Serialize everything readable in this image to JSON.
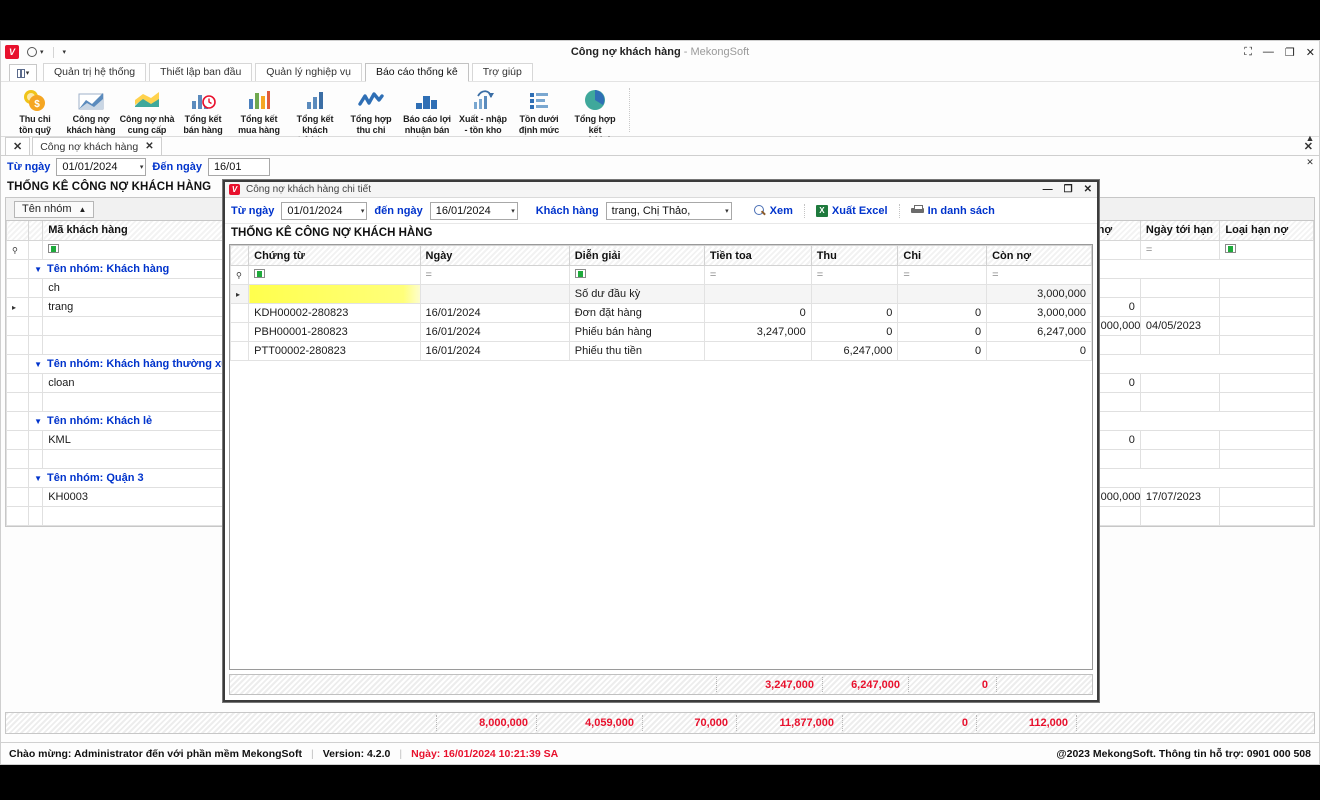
{
  "window": {
    "title": "Công nợ khách hàng",
    "title_suffix": "- MekongSoft",
    "logo": "V",
    "controls": {
      "restore_small": "⛶",
      "minimize": "—",
      "maximize": "❐",
      "close": "✕"
    }
  },
  "ribbon": {
    "tabs": [
      {
        "label": "Quản trị hệ thống",
        "active": false
      },
      {
        "label": "Thiết lập ban đầu",
        "active": false
      },
      {
        "label": "Quản lý nghiệp vụ",
        "active": false
      },
      {
        "label": "Báo cáo thống kê",
        "active": true
      },
      {
        "label": "Trợ giúp",
        "active": false
      }
    ],
    "buttons": [
      {
        "line1": "Thu chi",
        "line2": "tồn quỹ",
        "icon": "coins-money-icon"
      },
      {
        "line1": "Công nợ",
        "line2": "khách hàng",
        "icon": "area-chart-icon"
      },
      {
        "line1": "Công nợ nhà",
        "line2": "cung cấp",
        "icon": "layered-area-icon"
      },
      {
        "line1": "Tổng kết",
        "line2": "bán hàng",
        "icon": "bar-chart-clock-icon"
      },
      {
        "line1": "Tổng kết",
        "line2": "mua hàng",
        "icon": "color-bars-icon"
      },
      {
        "line1": "Tổng kết khách",
        "line2": "trả hàng",
        "icon": "small-bars-icon"
      },
      {
        "line1": "Tổng hợp",
        "line2": "thu chi",
        "icon": "zigzag-line-icon"
      },
      {
        "line1": "Báo cáo lợi",
        "line2": "nhuận bán hàng",
        "icon": "building-bars-icon"
      },
      {
        "line1": "Xuất - nhập",
        "line2": "- tồn kho",
        "icon": "bars-arrow-icon"
      },
      {
        "line1": "Tồn dưới",
        "line2": "định mức",
        "icon": "list-bars-icon"
      },
      {
        "line1": "Tổng hợp kết",
        "line2": "quả kinh doanh",
        "icon": "pie-chart-icon"
      }
    ]
  },
  "doctabs": {
    "close_all": "✕",
    "tabs": [
      {
        "label": "Công nợ khách hàng",
        "close": "✕"
      }
    ],
    "right_close": "✕"
  },
  "main_filter": {
    "from_label": "Từ ngày",
    "from_value": "01/01/2024",
    "to_label": "Đến ngày",
    "to_value": "16/01"
  },
  "main_heading": "THỐNG KÊ CÔNG NỢ KHÁCH HÀNG",
  "groupbar": {
    "chip": "Tên nhóm",
    "sort_arrow": "▲"
  },
  "main_grid": {
    "columns": [
      "Mã khách hàng",
      "nợ",
      "Ngày tới hạn",
      "Loại hạn nợ"
    ],
    "filter_row": [
      "filter-icon",
      "",
      "=",
      "filter-icon"
    ],
    "groups": [
      {
        "title": "Tên nhóm: Khách hàng",
        "rows": [
          {
            "code": "ch",
            "no": "",
            "ngay_toi_han": "",
            "loai": "",
            "selected": false
          },
          {
            "code": "trang",
            "no": "",
            "ngay_toi_han": "",
            "loai": "",
            "selected": true
          }
        ]
      },
      {
        "title": "Tên nhóm: Khách hàng thường xuyên",
        "rows": [
          {
            "code": "cloan",
            "no": "0",
            "ngay_toi_han": "",
            "loai": "",
            "selected": false
          }
        ]
      },
      {
        "title": "Tên nhóm: Khách lẻ",
        "rows": [
          {
            "code": "KML",
            "no": "0",
            "ngay_toi_han": "",
            "loai": "",
            "selected": false
          }
        ]
      },
      {
        "title": "Tên nhóm: Quận 3",
        "rows": [
          {
            "code": "KH0003",
            "no": ",000,000",
            "ngay_toi_han": "17/07/2023",
            "loai": "",
            "selected": false
          }
        ]
      }
    ],
    "right_values": [
      {
        "no": "0",
        "date": ""
      },
      {
        "no": ",000,000",
        "date": "04/05/2023"
      }
    ]
  },
  "main_totals": [
    "8,000,000",
    "4,059,000",
    "70,000",
    "11,877,000",
    "0",
    "112,000"
  ],
  "dialog": {
    "logo": "V",
    "title": "Công nợ khách hàng chi tiết",
    "controls": {
      "minimize": "—",
      "maximize": "❐",
      "close": "✕"
    },
    "filter": {
      "from_label": "Từ ngày",
      "from_value": "01/01/2024",
      "to_label": "đến ngày",
      "to_value": "16/01/2024",
      "customer_label": "Khách hàng",
      "customer_value": "trang, Chị Thảo,"
    },
    "actions": [
      {
        "label": "Xem",
        "icon": "magnifier-icon"
      },
      {
        "label": "Xuất Excel",
        "icon": "excel-icon"
      },
      {
        "label": "In danh sách",
        "icon": "printer-icon"
      }
    ],
    "heading": "THỐNG KÊ CÔNG NỢ KHÁCH HÀNG",
    "columns": [
      "Chứng từ",
      "Ngày",
      "Diễn giải",
      "Tiền toa",
      "Thu",
      "Chi",
      "Còn nợ"
    ],
    "filter_row": [
      "filter-icon",
      "=",
      "filter-icon",
      "=",
      "=",
      "=",
      "="
    ],
    "rows": [
      {
        "chung_tu": "",
        "ngay": "",
        "dien_giai": "Số dư đầu kỳ",
        "tien_toa": "",
        "thu": "",
        "chi": "",
        "con_no": "3,000,000",
        "highlight": true
      },
      {
        "chung_tu": "KDH00002-280823",
        "ngay": "16/01/2024",
        "dien_giai": "Đơn đặt hàng",
        "tien_toa": "0",
        "thu": "0",
        "chi": "0",
        "con_no": "3,000,000",
        "highlight": false
      },
      {
        "chung_tu": "PBH00001-280823",
        "ngay": "16/01/2024",
        "dien_giai": "Phiếu bán hàng",
        "tien_toa": "3,247,000",
        "thu": "0",
        "chi": "0",
        "con_no": "6,247,000",
        "highlight": false
      },
      {
        "chung_tu": "PTT00002-280823",
        "ngay": "16/01/2024",
        "dien_giai": "Phiếu thu tiền",
        "tien_toa": "",
        "thu": "6,247,000",
        "chi": "0",
        "con_no": "0",
        "highlight": false
      }
    ],
    "totals": {
      "tien_toa": "3,247,000",
      "thu": "6,247,000",
      "chi": "0",
      "con_no": ""
    }
  },
  "statusbar": {
    "welcome": "Chào mừng: Administrator đến với phần mềm MekongSoft",
    "version": "Version: 4.2.0",
    "datetime": "Ngày: 16/01/2024 10:21:39 SA",
    "copyright": "@2023 MekongSoft. Thông tin hỗ trợ: 0901 000 508"
  }
}
